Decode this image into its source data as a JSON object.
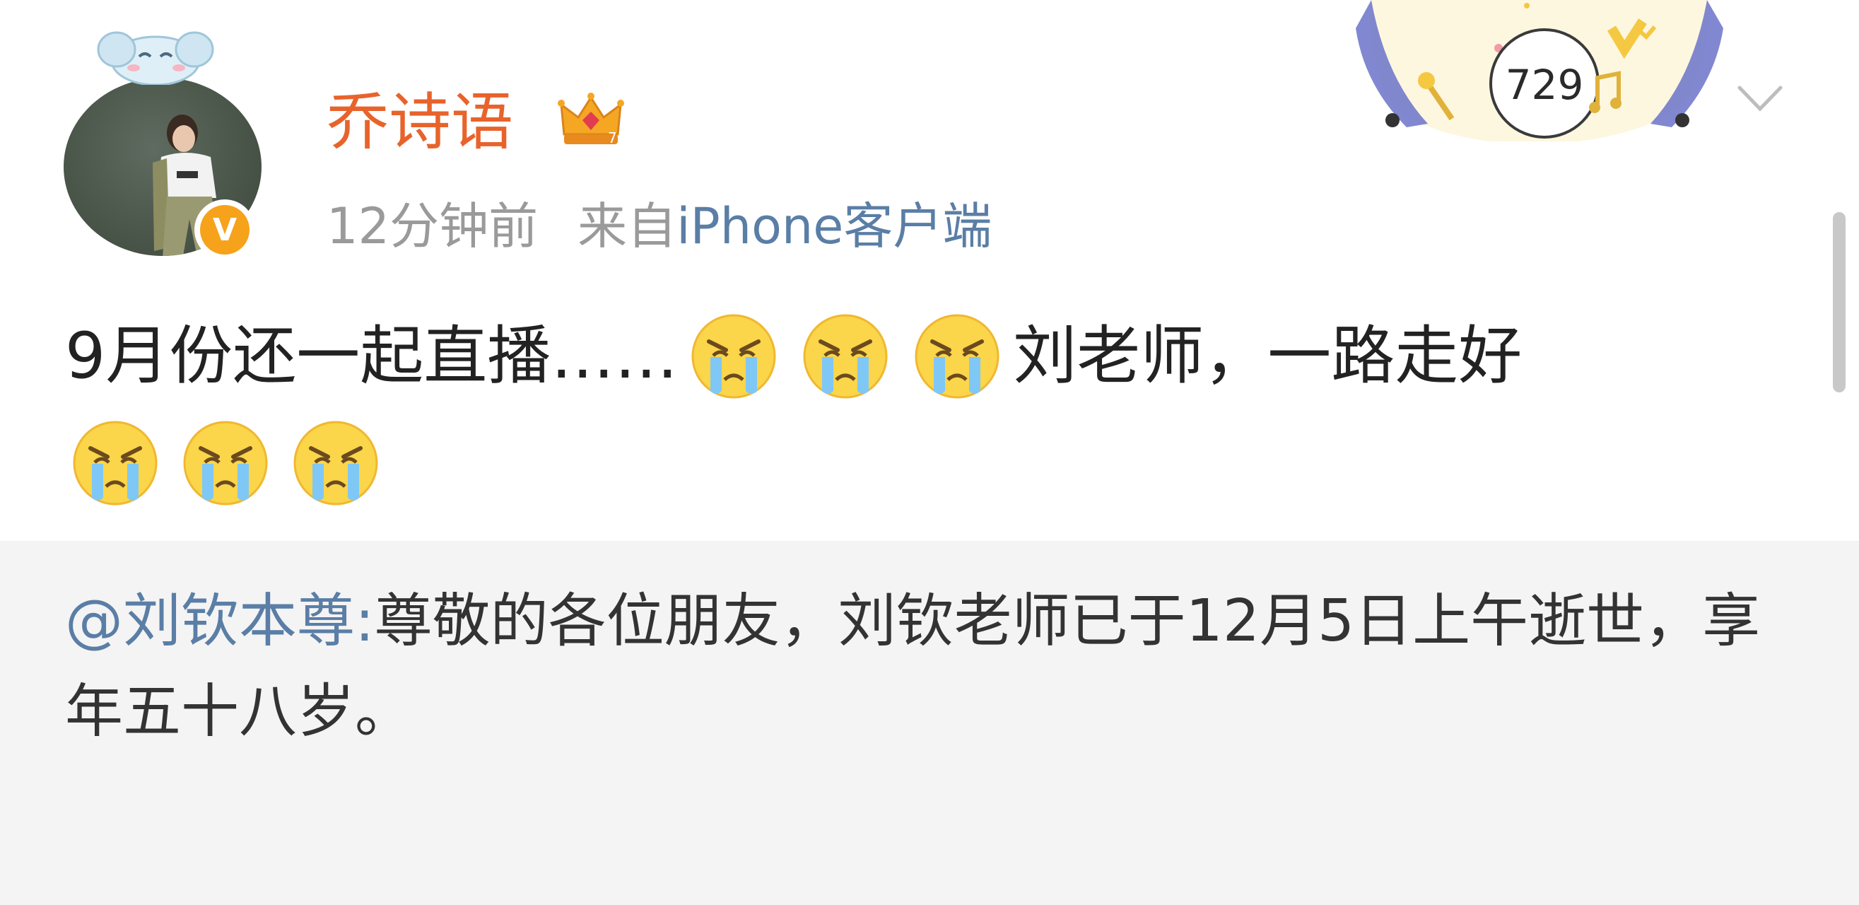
{
  "post": {
    "author": "乔诗语",
    "time_ago": "12分钟前",
    "source_prefix": "来自",
    "source": "iPhone客户端",
    "text_line1_a": "9月份还一起直播……",
    "text_line1_b": "刘老师，一路走好",
    "emoji_name": "crying-face",
    "line1_emoji_count": 3,
    "line2_emoji_count": 3
  },
  "badge": {
    "card_number": "729"
  },
  "repost": {
    "mention": "@刘钦本尊",
    "separator": ":",
    "text": "尊敬的各位朋友，刘钦老师已于12月5日上午逝世，享年五十八岁。"
  },
  "colors": {
    "username": "#e8632c",
    "link": "#5a7ea6",
    "meta": "#9a9a9a",
    "verified": "#f7a21b",
    "repost_bg": "#f4f4f4"
  }
}
